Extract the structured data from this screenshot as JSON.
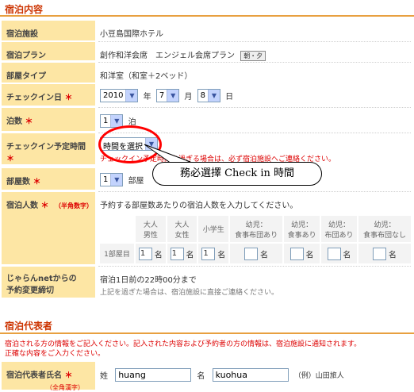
{
  "section1": {
    "title": "宿泊内容",
    "hotel": {
      "label": "宿泊施設",
      "value": "小豆島国際ホテル"
    },
    "plan": {
      "label": "宿泊プラン",
      "value": "創作和洋会席　エンジェル会席プラン",
      "meal_badge": "朝・夕"
    },
    "room_type": {
      "label": "部屋タイプ",
      "value": "和洋室（和室＋2ベッド）"
    },
    "checkin_date": {
      "label": "チェックイン日",
      "year": "2010",
      "year_unit": "年",
      "month": "7",
      "month_unit": "月",
      "day": "8",
      "day_unit": "日"
    },
    "nights": {
      "label": "泊数",
      "value": "1",
      "unit": "泊"
    },
    "checkin_time": {
      "label": "チェックイン予定時間",
      "value": "時間を選択",
      "note": "チェックイン予定時間を過ぎる場合は、必ず宿泊施設へご連絡ください。"
    },
    "rooms": {
      "label": "部屋数",
      "value": "1",
      "unit": "部屋"
    },
    "guests": {
      "label": "宿泊人数",
      "label_note": "（半角数字）",
      "intro": "予約する部屋数あたりの宿泊人数を入力してください。",
      "columns": [
        "大人\n男性",
        "大人\n女性",
        "小学生",
        "幼児：\n食事布団あり",
        "幼児：\n食事あり",
        "幼児：\n布団あり",
        "幼児：\n食事布団なし"
      ],
      "row_label": "1部屋目",
      "values": [
        "1",
        "1",
        "1",
        "",
        "",
        "",
        ""
      ],
      "unit": "名"
    },
    "deadline": {
      "label": "じゃらんnetからの\n予約変更締切",
      "value": "宿泊1日前の22時00分まで",
      "note": "上記を過ぎた場合は、宿泊施設に直接ご連絡ください。"
    },
    "required_mark": "＊"
  },
  "annotation": {
    "text": "務必選擇 Check in 時間"
  },
  "section2": {
    "title": "宿泊代表者",
    "notice_line1": "宿泊される方の情報をご記入ください。記入された内容および予約者の方の情報は、宿泊施設に通知されます。",
    "notice_line2": "正確な内容をご入力ください。",
    "name": {
      "label": "宿泊代表者氏名",
      "sei_label": "姓",
      "sei_value": "huang",
      "mei_label": "名",
      "mei_value": "kuohua",
      "example": "（例）山田旅人",
      "sub_note": "（全角漢字）"
    }
  }
}
